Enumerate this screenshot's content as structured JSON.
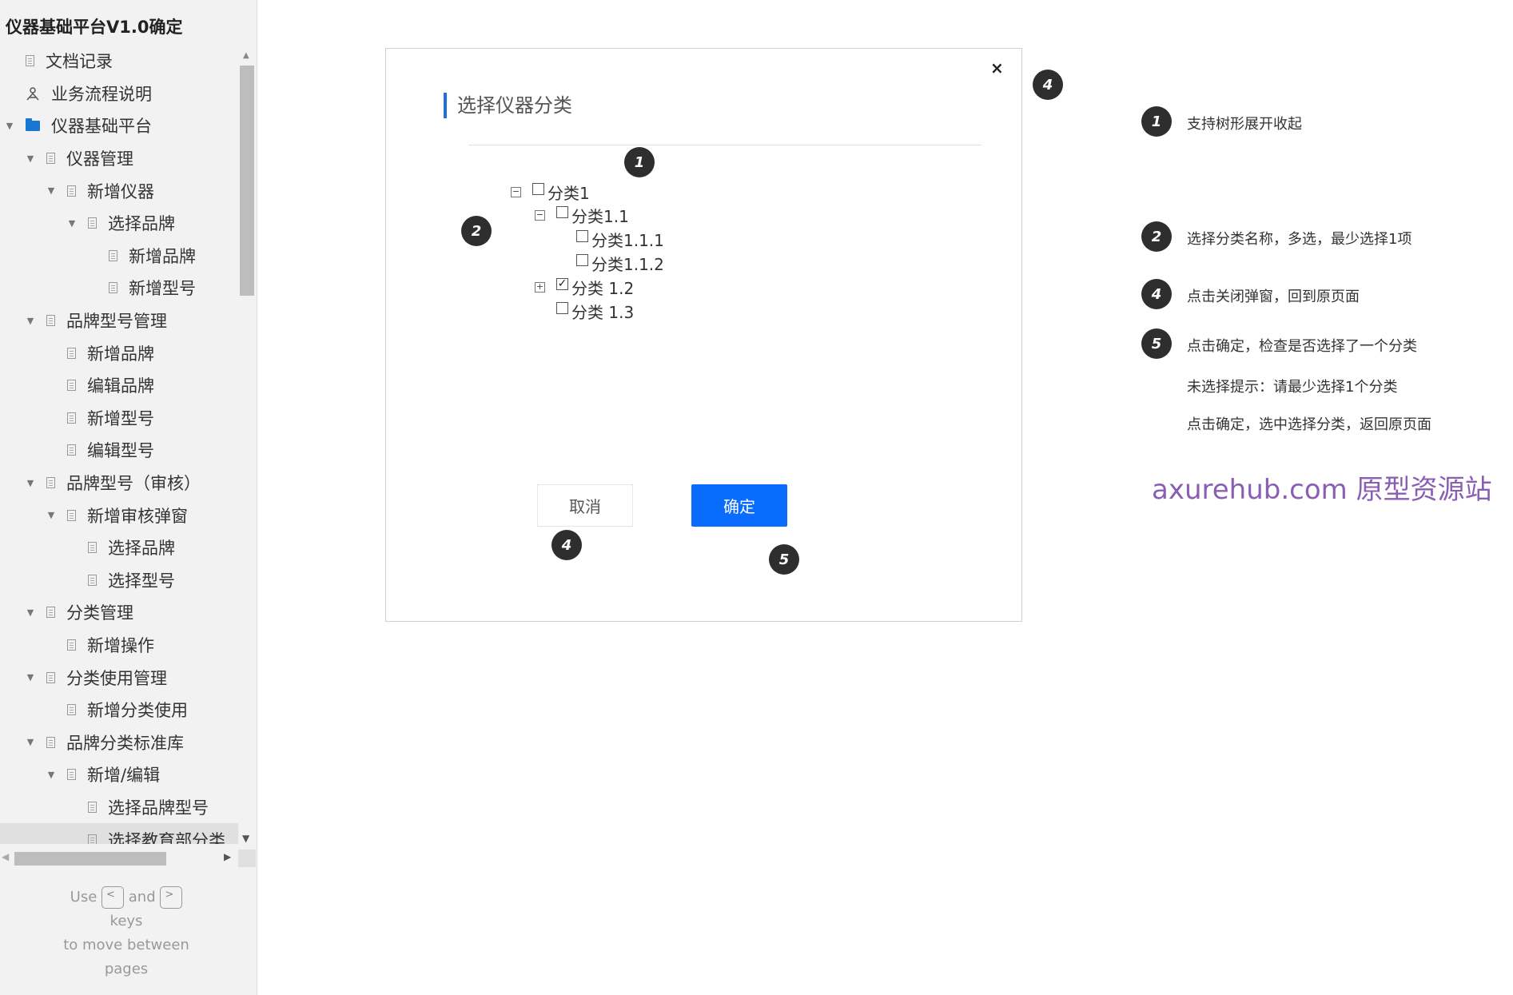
{
  "sidebar": {
    "title": "仪器基础平台V1.0确定",
    "items": [
      {
        "label": "文档记录",
        "level": 0,
        "icon": "page-icon",
        "expander": "none"
      },
      {
        "label": "业务流程说明",
        "level": 0,
        "icon": "flow-icon",
        "expander": "none"
      },
      {
        "label": "仪器基础平台",
        "level": 0,
        "icon": "folder-icon",
        "expander": "expanded"
      },
      {
        "label": "仪器管理",
        "level": 1,
        "icon": "page-icon",
        "expander": "expanded"
      },
      {
        "label": "新增仪器",
        "level": 2,
        "icon": "page-icon",
        "expander": "expanded"
      },
      {
        "label": "选择品牌",
        "level": 3,
        "icon": "page-icon",
        "expander": "expanded"
      },
      {
        "label": "新增品牌",
        "level": 4,
        "icon": "page-icon",
        "expander": "none"
      },
      {
        "label": "新增型号",
        "level": 4,
        "icon": "page-icon",
        "expander": "none"
      },
      {
        "label": "品牌型号管理",
        "level": 1,
        "icon": "page-icon",
        "expander": "expanded"
      },
      {
        "label": "新增品牌",
        "level": 2,
        "icon": "page-icon",
        "expander": "none"
      },
      {
        "label": "编辑品牌",
        "level": 2,
        "icon": "page-icon",
        "expander": "none"
      },
      {
        "label": "新增型号",
        "level": 2,
        "icon": "page-icon",
        "expander": "none"
      },
      {
        "label": "编辑型号",
        "level": 2,
        "icon": "page-icon",
        "expander": "none"
      },
      {
        "label": "品牌型号（审核）",
        "level": 1,
        "icon": "page-icon",
        "expander": "expanded"
      },
      {
        "label": "新增审核弹窗",
        "level": 2,
        "icon": "page-icon",
        "expander": "expanded"
      },
      {
        "label": "选择品牌",
        "level": 3,
        "icon": "page-icon",
        "expander": "none"
      },
      {
        "label": "选择型号",
        "level": 3,
        "icon": "page-icon",
        "expander": "none"
      },
      {
        "label": "分类管理",
        "level": 1,
        "icon": "page-icon",
        "expander": "expanded"
      },
      {
        "label": "新增操作",
        "level": 2,
        "icon": "page-icon",
        "expander": "none"
      },
      {
        "label": "分类使用管理",
        "level": 1,
        "icon": "page-icon",
        "expander": "expanded"
      },
      {
        "label": "新增分类使用",
        "level": 2,
        "icon": "page-icon",
        "expander": "none"
      },
      {
        "label": "品牌分类标准库",
        "level": 1,
        "icon": "page-icon",
        "expander": "expanded"
      },
      {
        "label": "新增/编辑",
        "level": 2,
        "icon": "page-icon",
        "expander": "expanded"
      },
      {
        "label": "选择品牌型号",
        "level": 3,
        "icon": "page-icon",
        "expander": "none"
      },
      {
        "label": "选择教育部分类",
        "level": 3,
        "icon": "page-icon",
        "expander": "none",
        "selected": true
      }
    ],
    "hint": {
      "use": "Use",
      "and": "and",
      "keys": "keys",
      "move": "to move between",
      "pages": "pages",
      "prev_key": "<",
      "next_key": ">"
    }
  },
  "dialog": {
    "title": "选择仪器分类",
    "close_glyph": "×",
    "tree": [
      {
        "label": "分类1",
        "toggle": "minus",
        "checked": false
      },
      {
        "label": "分类1.1",
        "toggle": "minus",
        "checked": false
      },
      {
        "label": "分类1.1.1",
        "toggle": "none",
        "checked": false
      },
      {
        "label": "分类1.1.2",
        "toggle": "none",
        "checked": false
      },
      {
        "label": "分类 1.2",
        "toggle": "plus",
        "checked": true
      },
      {
        "label": "分类 1.3",
        "toggle": "none",
        "checked": false
      }
    ],
    "cancel_label": "取消",
    "ok_label": "确定"
  },
  "markers": {
    "tree": "1",
    "check": "2",
    "close": "4",
    "cancel": "4",
    "ok": "5"
  },
  "notes": [
    {
      "num": "1",
      "text": "支持树形展开收起"
    },
    {
      "num": "2",
      "text": "选择分类名称，多选，最少选择1项"
    },
    {
      "num": "4",
      "text": "点击关闭弹窗，回到原页面"
    },
    {
      "num": "5",
      "text": "点击确定，检查是否选择了一个分类"
    },
    {
      "num": "",
      "text": "未选择提示：请最少选择1个分类"
    },
    {
      "num": "",
      "text": "点击确定，选中选择分类，返回原页面"
    }
  ],
  "watermark": "axurehub.com 原型资源站",
  "colors": {
    "accent": "#0a6cff",
    "title_bar": "#1e6fd9",
    "watermark": "#8a5fb3",
    "marker": "#2e2e2e"
  }
}
